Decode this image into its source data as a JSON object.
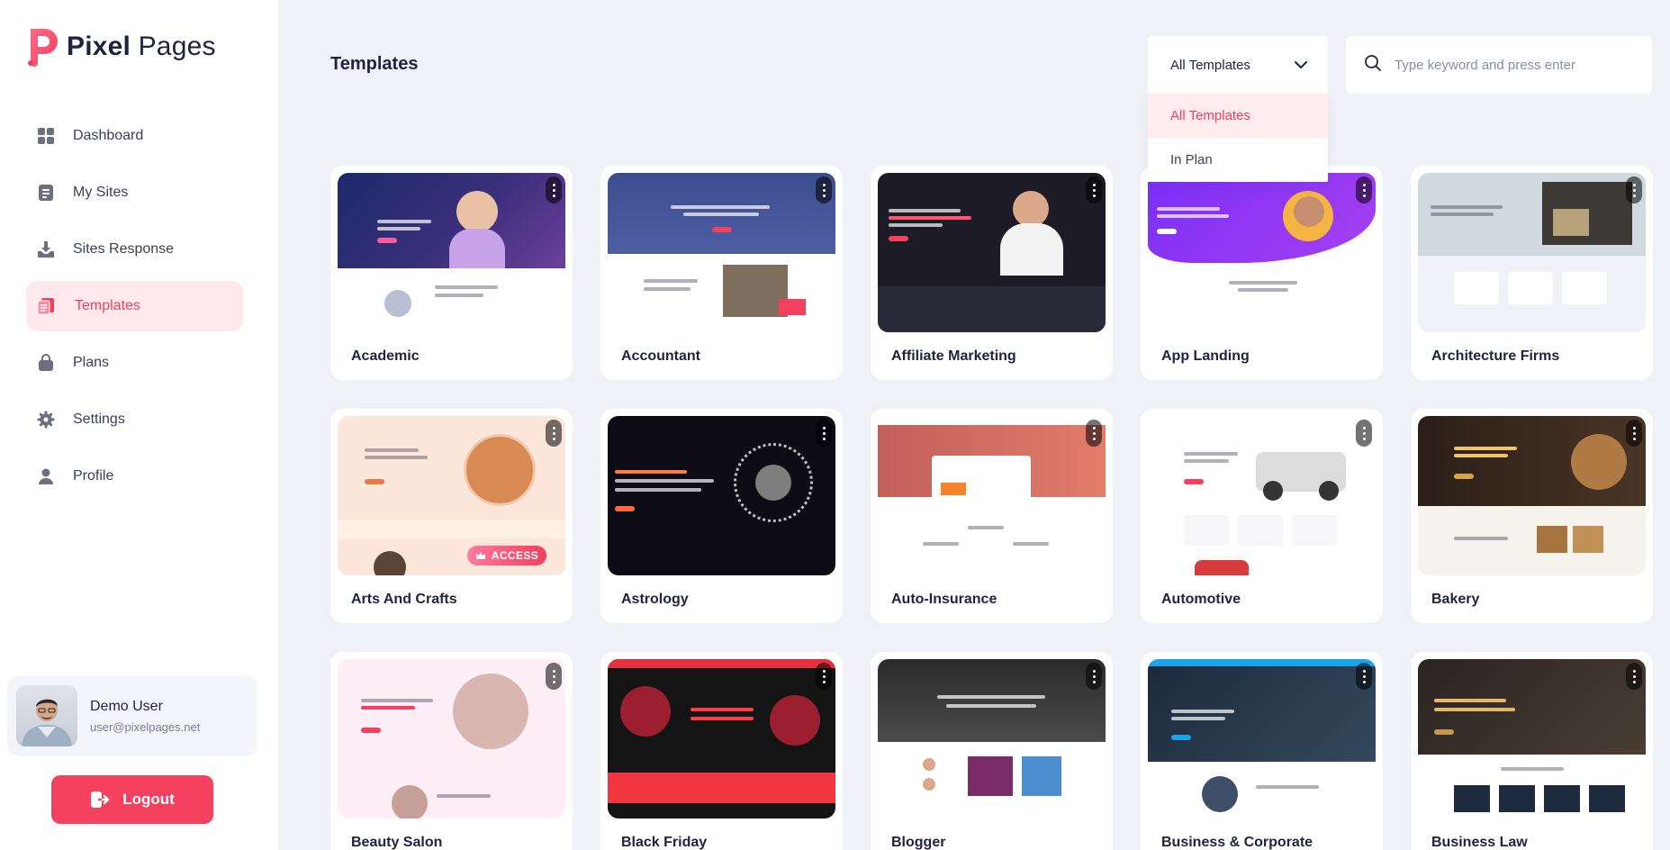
{
  "brand": {
    "name_bold": "Pixel",
    "name_rest": " Pages"
  },
  "sidebar": {
    "items": [
      {
        "label": "Dashboard",
        "icon": "dashboard-icon",
        "active": false
      },
      {
        "label": "My Sites",
        "icon": "sites-icon",
        "active": false
      },
      {
        "label": "Sites Response",
        "icon": "download-icon",
        "active": false
      },
      {
        "label": "Templates",
        "icon": "templates-icon",
        "active": true
      },
      {
        "label": "Plans",
        "icon": "bag-icon",
        "active": false
      },
      {
        "label": "Settings",
        "icon": "gear-icon",
        "active": false
      },
      {
        "label": "Profile",
        "icon": "user-icon",
        "active": false
      }
    ]
  },
  "user": {
    "name": "Demo User",
    "email": "user@pixelpages.net"
  },
  "logout_label": "Logout",
  "page_title": "Templates",
  "filter": {
    "selected": "All Templates",
    "options": [
      "All Templates",
      "In Plan"
    ]
  },
  "search": {
    "placeholder": "Type keyword and press enter",
    "value": ""
  },
  "templates": [
    {
      "title": "Academic"
    },
    {
      "title": "Accountant"
    },
    {
      "title": "Affiliate Marketing"
    },
    {
      "title": "App Landing"
    },
    {
      "title": "Architecture Firms"
    },
    {
      "title": "Arts And Crafts",
      "badge": "ACCESS"
    },
    {
      "title": "Astrology"
    },
    {
      "title": "Auto-Insurance"
    },
    {
      "title": "Automotive"
    },
    {
      "title": "Bakery"
    },
    {
      "title": "Beauty Salon"
    },
    {
      "title": "Black Friday"
    },
    {
      "title": "Blogger"
    },
    {
      "title": "Business & Corporate"
    },
    {
      "title": "Business Law"
    }
  ],
  "colors": {
    "accent": "#f2405e",
    "accent_soft": "#ffe9ec",
    "background": "#f0f1f7"
  }
}
